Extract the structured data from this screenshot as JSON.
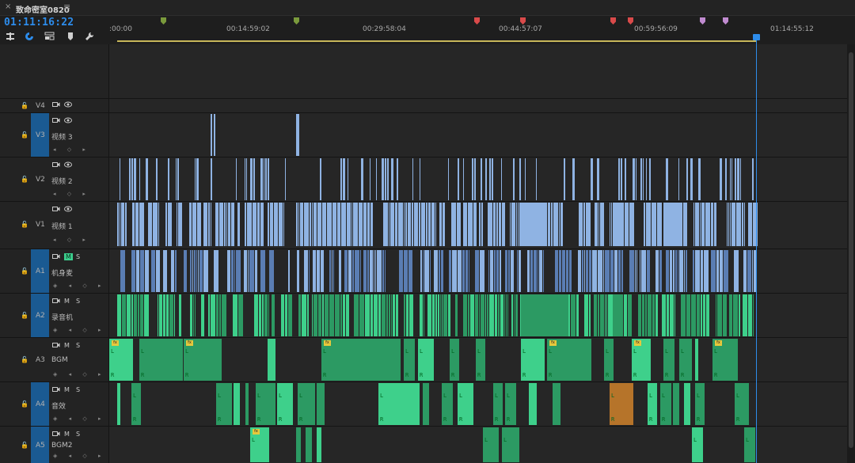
{
  "tab": {
    "close_glyph": "×",
    "title": "致命密室0820",
    "menu_glyph": "≡"
  },
  "timecode": "01:11:16:22",
  "toolbar": [
    "nest-icon",
    "snap-icon",
    "linked-selection-icon",
    "marker-icon",
    "wrench-icon"
  ],
  "ruler": {
    "labels": [
      ":00:00",
      "00:14:59:02",
      "00:29:58:04",
      "00:44:57:07",
      "00:59:56:09",
      "01:14:55:12"
    ],
    "marker_colors": [
      "#7a9a3c",
      "#7a9a3c",
      "#d94a4a",
      "#d94a4a",
      "#d94a4a",
      "#d94a4a",
      "#c08bd0",
      "#c08bd0"
    ]
  },
  "tracks": [
    {
      "id": "V4",
      "name": "",
      "kind": "video",
      "targeted": false
    },
    {
      "id": "V3",
      "name": "视频 3",
      "kind": "video",
      "targeted": true
    },
    {
      "id": "V2",
      "name": "视频 2",
      "kind": "video",
      "targeted": false
    },
    {
      "id": "V1",
      "name": "视频 1",
      "kind": "video",
      "targeted": false
    },
    {
      "id": "A1",
      "name": "机身麦",
      "kind": "audio",
      "targeted": true,
      "mute_on": true
    },
    {
      "id": "A2",
      "name": "录音机",
      "kind": "audio",
      "targeted": true,
      "mute_on": false
    },
    {
      "id": "A3",
      "name": "BGM",
      "kind": "audio",
      "targeted": false,
      "mute_on": false
    },
    {
      "id": "A4",
      "name": "音效",
      "kind": "audio",
      "targeted": true,
      "mute_on": false
    },
    {
      "id": "A5",
      "name": "BGM2",
      "kind": "audio",
      "targeted": true,
      "mute_on": false
    }
  ],
  "labels": {
    "mute": "M",
    "solo": "S",
    "lock": "🔓",
    "clip_left": "L",
    "clip_right": "R",
    "fx": "fx"
  },
  "colors": {
    "video_clip": "#8fb3e3",
    "audio_clip": "#2c9a63",
    "playhead": "#2d8ceb",
    "target": "#1a5a92",
    "sfx_orange": "#b6742a"
  }
}
